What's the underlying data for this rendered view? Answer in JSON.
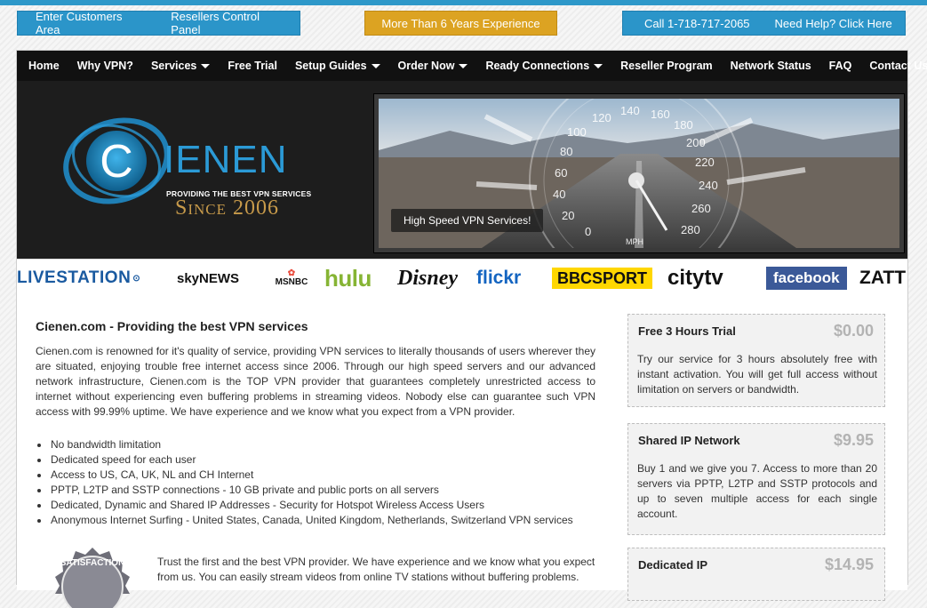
{
  "topbar": {
    "customers": "Enter Customers Area",
    "resellers": "Resellers Control Panel",
    "experience": "More Than 6 Years Experience",
    "phone": "Call 1-718-717-2065",
    "help": "Need Help? Click Here"
  },
  "nav": {
    "items": [
      {
        "label": "Home"
      },
      {
        "label": "Why VPN?"
      },
      {
        "label": "Services"
      },
      {
        "label": "Free Trial"
      },
      {
        "label": "Setup Guides"
      },
      {
        "label": "Order Now"
      },
      {
        "label": "Ready Connections"
      },
      {
        "label": "Reseller Program"
      },
      {
        "label": "Network Status"
      },
      {
        "label": "FAQ"
      },
      {
        "label": "Contact Us"
      }
    ]
  },
  "logo": {
    "letter": "C",
    "word": "IENEN",
    "tagline": "PROVIDING THE BEST VPN SERVICES",
    "since": "Since 2006"
  },
  "banner": {
    "caption": "High Speed VPN Services!",
    "unit": "MPH",
    "speeds": [
      "0",
      "20",
      "40",
      "60",
      "80",
      "100",
      "120",
      "140",
      "160",
      "180",
      "200",
      "220",
      "240",
      "260",
      "280"
    ]
  },
  "brands": [
    "LIVESTATION",
    "skyNEWS",
    "MSNBC",
    "hulu",
    "Disney",
    "flickr",
    "BBCSPORT",
    "citytv",
    "facebook",
    "ZATT"
  ],
  "content": {
    "title": "Cienen.com - Providing the best VPN services",
    "intro": "Cienen.com is renowned for it's quality of service, providing VPN services to literally thousands of users wherever they are situated, enjoying trouble free internet access since 2006. Through our high speed servers and our advanced network infrastructure, Cienen.com is the TOP VPN provider that guarantees completely unrestricted access to internet without experiencing even buffering problems in streaming videos. Nobody else can guarantee such VPN access with 99.99% uptime. We have experience and we know what you expect from a VPN provider.",
    "bullets": [
      "No bandwidth limitation",
      "Dedicated speed for each user",
      "Access to US, CA, UK, NL and CH Internet",
      "PPTP, L2TP and SSTP connections - 10 GB private and public ports on all servers",
      "Dedicated, Dynamic and Shared IP Addresses - Security for Hotspot Wireless Access Users",
      "Anonymous Internet Surfing - United States, Canada, United Kingdom, Netherlands, Switzerland VPN services"
    ],
    "badge": "SATISFACTION",
    "trust": "Trust the first and the best VPN provider. We have experience and we know what you expect from us. You can easily stream videos from online TV stations without buffering problems."
  },
  "plans": [
    {
      "name": "Free 3 Hours Trial",
      "price": "$0.00",
      "desc": "Try our service for 3 hours absolutely free with instant activation. You will get full access without limitation on servers or bandwidth."
    },
    {
      "name": "Shared IP Network",
      "price": "$9.95",
      "desc": "Buy 1 and we give you 7. Access to more than 20 servers via PPTP, L2TP and SSTP protocols and up to seven multiple access for each single account."
    },
    {
      "name": "Dedicated IP",
      "price": "$14.95",
      "desc": ""
    }
  ],
  "colors": {
    "accent": "#2b95c9",
    "gold": "#dca322",
    "nav": "#111111",
    "logo_blue": "#2b9ad6"
  }
}
